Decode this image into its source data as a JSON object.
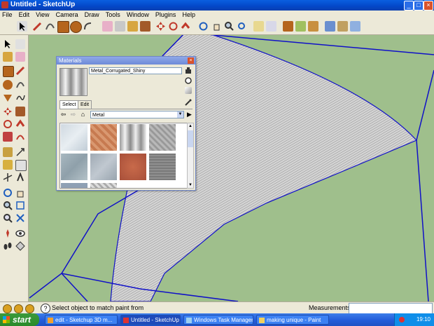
{
  "window": {
    "title": "Untitled - SketchUp",
    "minimize": "_",
    "maximize": "□",
    "close": "×"
  },
  "menu": [
    "File",
    "Edit",
    "View",
    "Camera",
    "Draw",
    "Tools",
    "Window",
    "Plugins",
    "Help"
  ],
  "materials": {
    "title": "Materials",
    "close": "×",
    "material_name": "Metal_Corrugated_Shiny",
    "tabs": [
      "Select",
      "Edit"
    ],
    "library": "Metal",
    "back": "⇦",
    "forward": "⇨",
    "home": "⌂",
    "dropdown": "▼",
    "details": "▶",
    "scroll_up": "▲",
    "scroll_down": "▼"
  },
  "status": {
    "message": "Select object to match paint from",
    "measurements_label": "Measurements",
    "measurements_value": "",
    "help": "?"
  },
  "taskbar": {
    "start": "start",
    "tasks": [
      "edit - Sketchup 3D m...",
      "Untitled - SketchUp",
      "Windows Task Manager",
      "making unique - Paint"
    ],
    "clock": "19:10"
  },
  "colors": {
    "viewport": "#9fbf8c",
    "edges": "#1010c8",
    "face": "#c8c8c8"
  }
}
